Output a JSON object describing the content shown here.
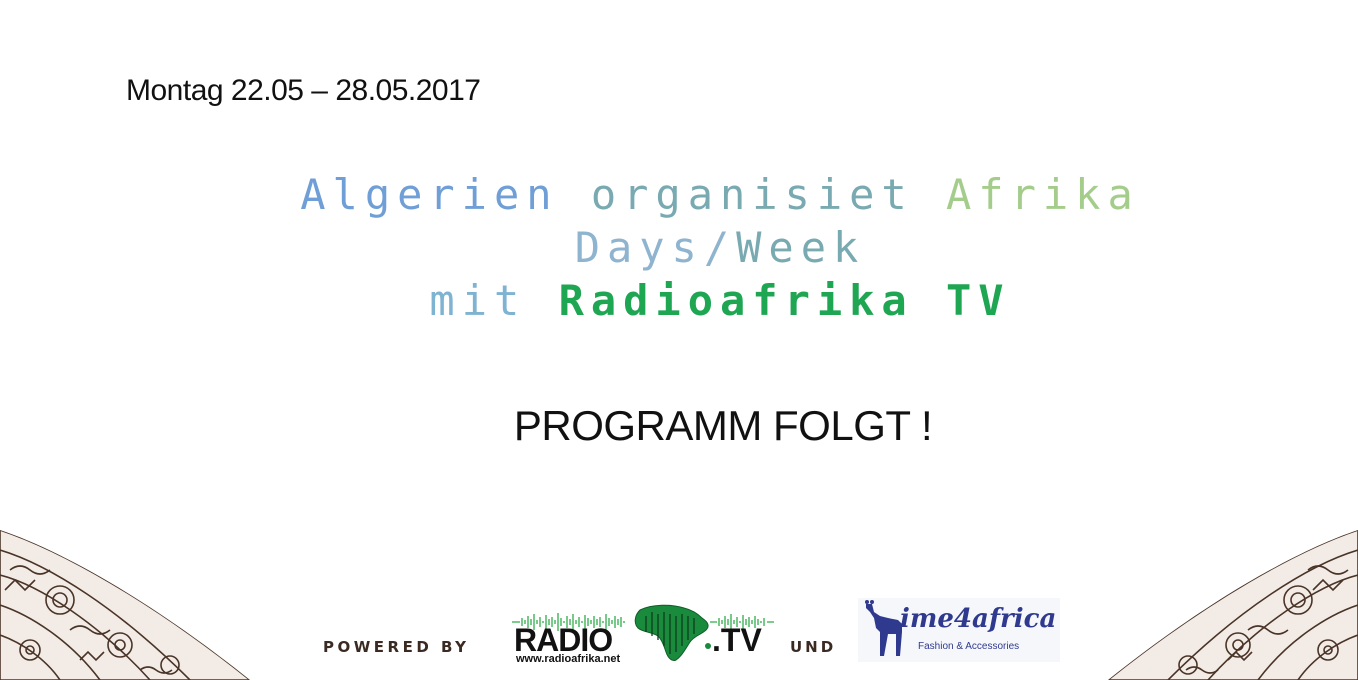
{
  "date_range": "Montag 22.05 – 28.05.2017",
  "headline": {
    "line1": {
      "part1": "Algerien",
      "part2": "organisiet",
      "part3": "Afrika"
    },
    "line2": {
      "part1": "Days/",
      "part2": "Week"
    },
    "line3": {
      "part1": "mit",
      "part2": "Radioafrika TV"
    }
  },
  "program_notice": "PROGRAMM FOLGT !",
  "footer": {
    "powered_by": "POWERED BY",
    "radio_logo": {
      "word": "RADIO",
      "tv": ".TV",
      "url": "www.radioafrika.net"
    },
    "und": "UND",
    "time4africa_logo": {
      "word": "ime4africa",
      "tagline": "Fashion & Accessories"
    }
  },
  "colors": {
    "headline_blue": "#6f9fd6",
    "headline_teal": "#79aab2",
    "headline_green_light": "#a4cd8b",
    "radioafrika_green": "#1fa653",
    "time4africa_blue": "#2f3a8f",
    "pattern_brown": "#4a3428"
  }
}
